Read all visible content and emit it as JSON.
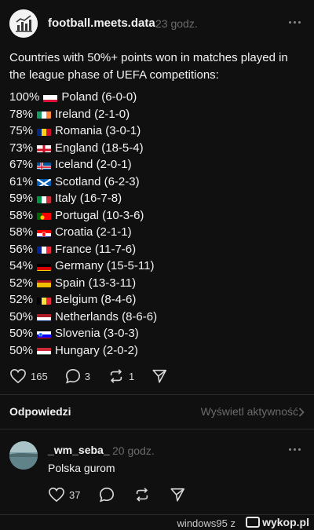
{
  "post": {
    "username": "football.meets.data",
    "time": "23 godz.",
    "intro": "Countries with 50%+ points won in matches played in the league phase of UEFA competitions:",
    "rows": [
      {
        "pct": "100%",
        "country": "Poland (6-0-0)",
        "flag": "poland"
      },
      {
        "pct": "78%",
        "country": "Ireland (2-1-0)",
        "flag": "ireland"
      },
      {
        "pct": "75%",
        "country": "Romania (3-0-1)",
        "flag": "romania"
      },
      {
        "pct": "73%",
        "country": "England (18-5-4)",
        "flag": "england"
      },
      {
        "pct": "67%",
        "country": "Iceland (2-0-1)",
        "flag": "iceland"
      },
      {
        "pct": "61%",
        "country": "Scotland (6-2-3)",
        "flag": "scotland"
      },
      {
        "pct": "59%",
        "country": "Italy (16-7-8)",
        "flag": "italy"
      },
      {
        "pct": "58%",
        "country": "Portugal (10-3-6)",
        "flag": "portugal"
      },
      {
        "pct": "58%",
        "country": "Croatia (2-1-1)",
        "flag": "croatia"
      },
      {
        "pct": "56%",
        "country": "France (11-7-6)",
        "flag": "france"
      },
      {
        "pct": "54%",
        "country": "Germany (15-5-11)",
        "flag": "germany"
      },
      {
        "pct": "52%",
        "country": "Spain (13-3-11)",
        "flag": "spain"
      },
      {
        "pct": "52%",
        "country": "Belgium (8-4-6)",
        "flag": "belgium"
      },
      {
        "pct": "50%",
        "country": "Netherlands (8-6-6)",
        "flag": "netherlands"
      },
      {
        "pct": "50%",
        "country": "Slovenia (3-0-3)",
        "flag": "slovenia"
      },
      {
        "pct": "50%",
        "country": "Hungary (2-0-2)",
        "flag": "hungary"
      }
    ],
    "likes": "165",
    "comments": "3",
    "reposts": "1"
  },
  "replies": {
    "header": "Odpowiedzi",
    "view_activity": "Wyświetl aktywność",
    "items": [
      {
        "username": "_wm_seba_",
        "time": "20 godz.",
        "text": "Polska gurom",
        "likes": "37"
      }
    ]
  },
  "watermark": {
    "user": "windows95",
    "separator": "z",
    "brand": "wykop.pl"
  },
  "colors": {
    "background": "#101010",
    "text": "#f3f3f3",
    "muted": "#6b6b6b",
    "divider": "#2a2a2a"
  }
}
